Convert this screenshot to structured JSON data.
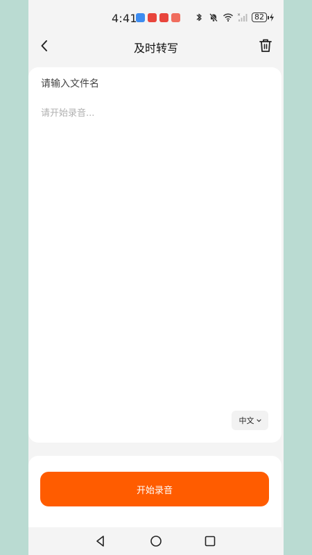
{
  "status_bar": {
    "time": "4:41",
    "battery": "82"
  },
  "header": {
    "title": "及时转写"
  },
  "editor": {
    "filename_placeholder": "请输入文件名",
    "transcript_placeholder": "请开始录音...",
    "language": "中文"
  },
  "actions": {
    "start_recording": "开始录音"
  },
  "colors": {
    "accent": "#ff5c00",
    "outer_background": "#badbd2"
  }
}
